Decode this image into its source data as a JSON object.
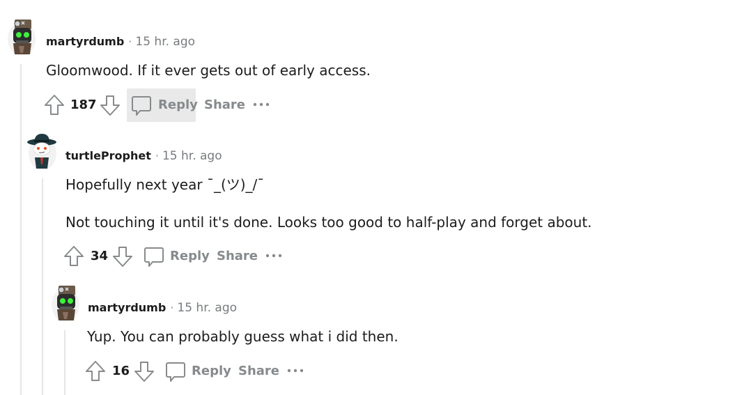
{
  "comments": [
    {
      "author": "martyrdumb",
      "time": "15 hr. ago",
      "avatar": "robot-knight-avatar",
      "body": [
        "Gloomwood. If it ever gets out of early access."
      ],
      "votes": "187",
      "reply_label": "Reply",
      "share_label": "Share",
      "more_label": "···"
    },
    {
      "author": "turtleProphet",
      "time": "15 hr. ago",
      "avatar": "hat-snoo-avatar",
      "body": [
        "Hopefully next year ¯_(ツ)_/¯",
        "Not touching it until it's done. Looks too good to half-play and forget about."
      ],
      "votes": "34",
      "reply_label": "Reply",
      "share_label": "Share",
      "more_label": "···"
    },
    {
      "author": "martyrdumb",
      "time": "15 hr. ago",
      "avatar": "robot-knight-avatar",
      "body": [
        "Yup. You can probably guess what i did then."
      ],
      "votes": "16",
      "reply_label": "Reply",
      "share_label": "Share",
      "more_label": "···"
    }
  ],
  "separator": "·",
  "colors": {
    "text": "#1c1c1c",
    "muted": "#878a8c",
    "thread_line": "#e6e6e6",
    "hover_bg": "#e9e9e9",
    "avatar_eye_green": "#3ef03e"
  }
}
